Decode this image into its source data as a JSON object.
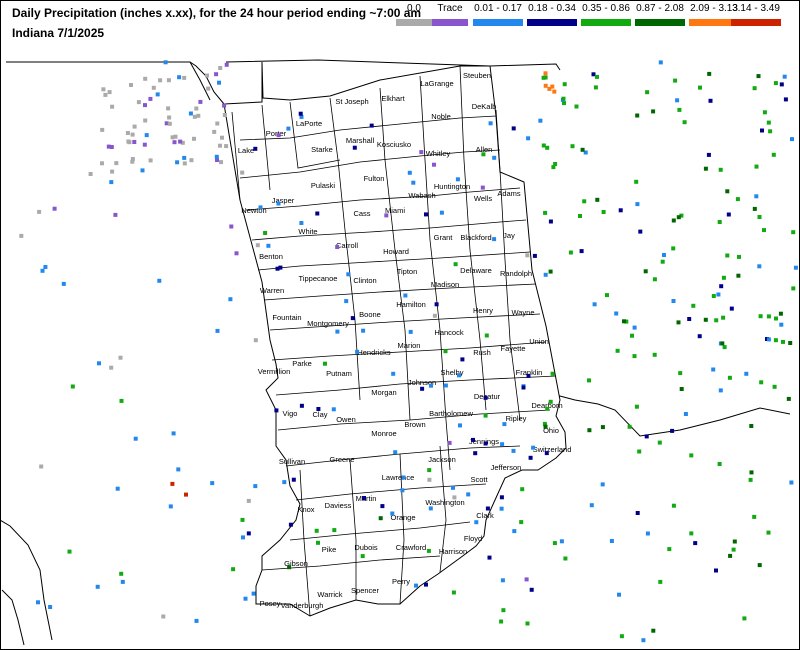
{
  "header": {
    "title": "Daily Precipitation (inches  x.xx),  for the 24 hour period ending ~7:00 am",
    "subtitle": "Indiana 7/1/2025"
  },
  "legend": [
    {
      "label": "0.0",
      "color": "#aaaaaa"
    },
    {
      "label": "Trace",
      "color": "#8855cc"
    },
    {
      "label": "0.01 - 0.17",
      "color": "#2288ee"
    },
    {
      "label": "0.18 - 0.34",
      "color": "#000088"
    },
    {
      "label": "0.35 - 0.86",
      "color": "#11aa11"
    },
    {
      "label": "0.87 - 2.08",
      "color": "#006600"
    },
    {
      "label": "2.09 - 3.13",
      "color": "#ff7711"
    },
    {
      "label": "3.14 - 3.49",
      "color": "#cc2200"
    }
  ],
  "counties": [
    "Steuben",
    "LaGrange",
    "Elkhart",
    "St Joseph",
    "LaPorte",
    "Porter",
    "Lake",
    "DeKalb",
    "Noble",
    "Allen",
    "Whitley",
    "Kosciusko",
    "Marshall",
    "Starke",
    "Jasper",
    "Newton",
    "Pulaski",
    "Fulton",
    "Wabash",
    "Huntington",
    "Wells",
    "Adams",
    "Miami",
    "Cass",
    "White",
    "Benton",
    "Carroll",
    "Howard",
    "Grant",
    "Blackford",
    "Jay",
    "Warren",
    "Tippecanoe",
    "Clinton",
    "Tipton",
    "Madison",
    "Delaware",
    "Randolph",
    "Fountain",
    "Montgomery",
    "Boone",
    "Hamilton",
    "Henry",
    "Wayne",
    "Vermillion",
    "Parke",
    "Hendricks",
    "Marion",
    "Hancock",
    "Rush",
    "Fayette",
    "Union",
    "Vigo",
    "Putnam",
    "Morgan",
    "Johnson",
    "Shelby",
    "Decatur",
    "Franklin",
    "Clay",
    "Owen",
    "Monroe",
    "Brown",
    "Bartholomew",
    "Ripley",
    "Dearborn",
    "Ohio",
    "Sullivan",
    "Greene",
    "Lawrence",
    "Jackson",
    "Jennings",
    "Switzerland",
    "Jefferson",
    "Knox",
    "Daviess",
    "Martin",
    "Orange",
    "Washington",
    "Scott",
    "Clark",
    "Floyd",
    "Harrison",
    "Pike",
    "Dubois",
    "Crawford",
    "Gibson",
    "Posey",
    "Vanderburgh",
    "Warrick",
    "Spencer",
    "Perry"
  ]
}
